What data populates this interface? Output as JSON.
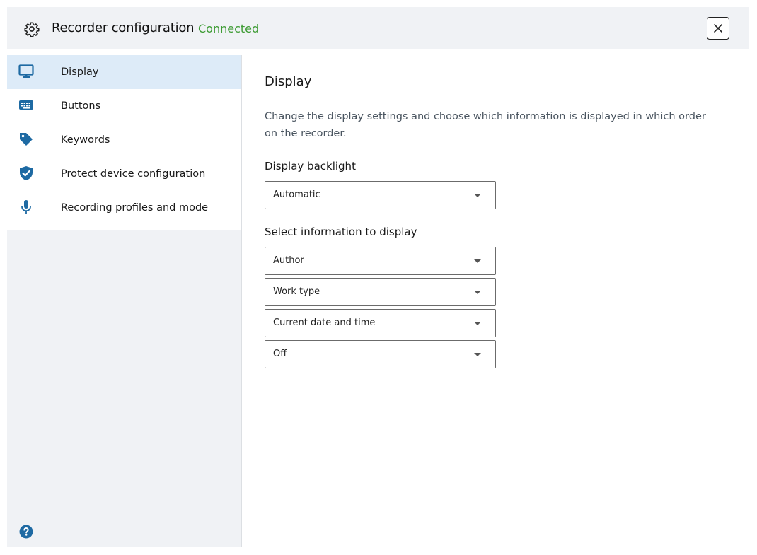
{
  "header": {
    "title": "Recorder configuration",
    "status": "Connected",
    "status_color": "#3f9c35"
  },
  "sidebar": {
    "items": [
      {
        "label": "Display",
        "icon": "monitor-icon",
        "active": true
      },
      {
        "label": "Buttons",
        "icon": "keyboard-icon",
        "active": false
      },
      {
        "label": "Keywords",
        "icon": "tag-icon",
        "active": false
      },
      {
        "label": "Protect device configuration",
        "icon": "shield-check-icon",
        "active": false
      },
      {
        "label": "Recording profiles and mode",
        "icon": "microphone-icon",
        "active": false
      }
    ],
    "help_icon": "help-icon",
    "accent_color": "#1e6aa3"
  },
  "main": {
    "title": "Display",
    "description": "Change the display settings and choose which information is displayed in which order on the recorder.",
    "backlight": {
      "label": "Display backlight",
      "value": "Automatic"
    },
    "info": {
      "label": "Select information to display",
      "selects": [
        {
          "value": "Author"
        },
        {
          "value": "Work type"
        },
        {
          "value": "Current date and time"
        },
        {
          "value": "Off"
        }
      ]
    }
  }
}
